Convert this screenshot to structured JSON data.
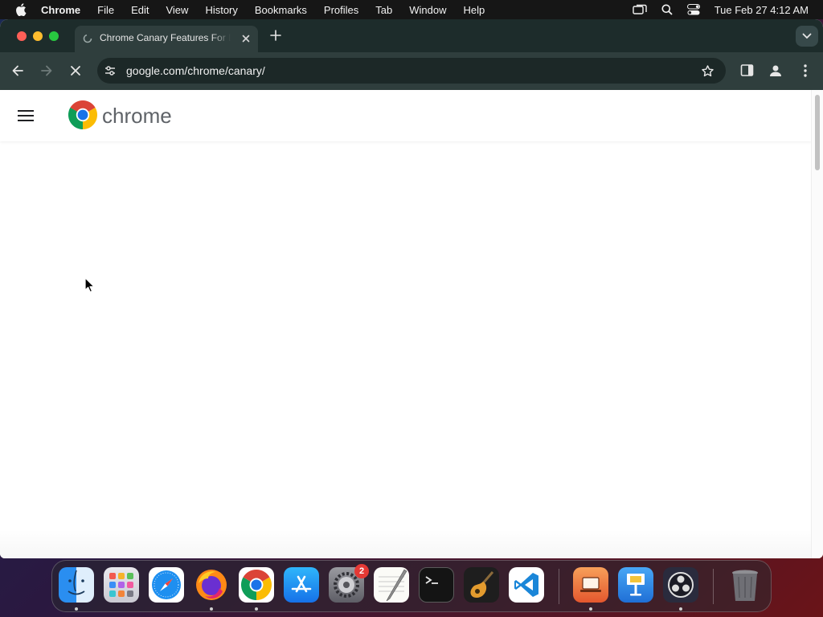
{
  "menubar": {
    "app_name": "Chrome",
    "items": [
      "File",
      "Edit",
      "View",
      "History",
      "Bookmarks",
      "Profiles",
      "Tab",
      "Window",
      "Help"
    ],
    "clock": "Tue Feb 27  4:12 AM"
  },
  "browser": {
    "tab": {
      "title": "Chrome Canary Features For Developers"
    },
    "address_bar": {
      "url": "google.com/chrome/canary/"
    }
  },
  "page": {
    "brand": "chrome"
  },
  "dock": {
    "apps": [
      "Finder",
      "Launchpad",
      "Safari",
      "Firefox",
      "Google Chrome",
      "App Store",
      "System Settings",
      "TextEdit",
      "Terminal",
      "GarageBand",
      "Visual Studio Code",
      "Screen Sharing",
      "Keynote",
      "OBS",
      "Trash"
    ],
    "settings_badge": "2"
  },
  "colors": {
    "tab_strip": "#1d2c2b",
    "toolbar": "#2f3e3d",
    "omnibox": "#1c2827",
    "brand_text": "#5f6368"
  }
}
